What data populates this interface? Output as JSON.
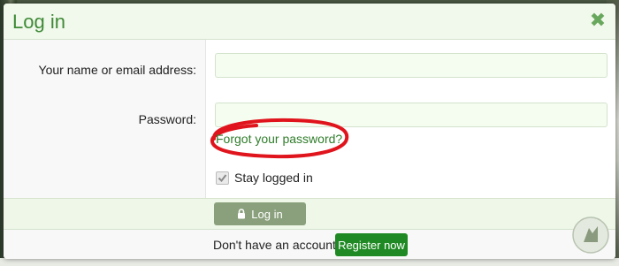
{
  "modal": {
    "title": "Log in",
    "close_icon": "close-icon"
  },
  "form": {
    "name_label": "Your name or email address:",
    "name_value": "",
    "name_placeholder": "",
    "password_label": "Password:",
    "password_value": "",
    "password_placeholder": "",
    "forgot_link": "Forgot your password?",
    "stay_logged_in_label": "Stay logged in",
    "stay_logged_in_checked": true
  },
  "actions": {
    "login_label": "Log in",
    "login_icon": "lock-icon"
  },
  "footer": {
    "prompt": "Don't have an account?",
    "register_label": "Register now"
  },
  "colors": {
    "accent_green": "#3f8a36",
    "register_green": "#1f8a23",
    "login_disabled": "#8aa07c",
    "annotation_red": "#e0141c"
  }
}
